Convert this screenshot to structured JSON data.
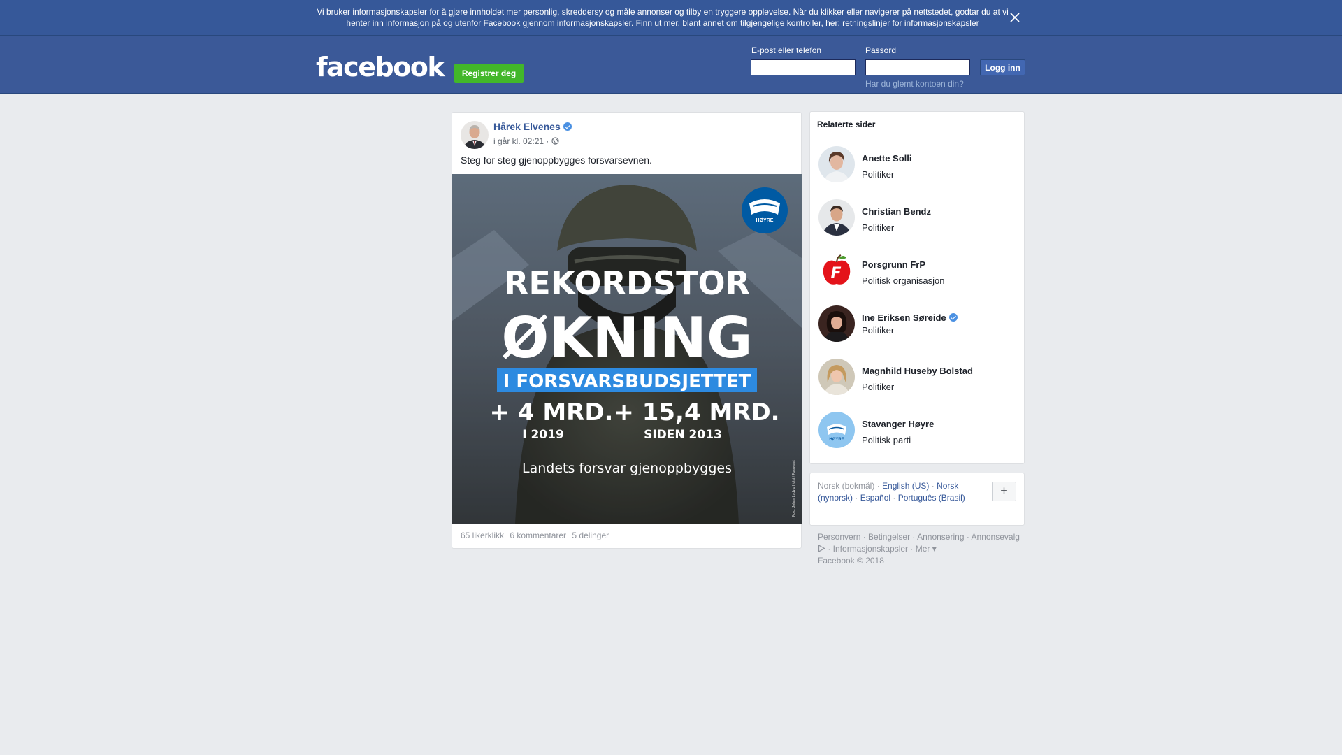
{
  "cookie_banner": {
    "text": "Vi bruker informasjonskapsler for å gjøre innholdet mer personlig, skreddersy og måle annonser og tilby en tryggere opplevelse. Når du klikker eller navigerer på nettstedet, godtar du at vi henter inn informasjon på og utenfor Facebook gjennom informasjonskapsler. Finn ut mer, blant annet om tilgjengelige kontroller, her:",
    "link": "retningslinjer for informasjonskapsler",
    "close_icon": "close-icon"
  },
  "header": {
    "logo": "facebook",
    "register_label": "Registrer deg",
    "email_label": "E-post eller telefon",
    "email_value": "",
    "password_label": "Passord",
    "password_value": "",
    "login_label": "Logg inn",
    "forgot_label": "Har du glemt kontoen din?"
  },
  "post": {
    "author": "Hårek Elvenes",
    "verified": true,
    "timestamp": "i går kl. 02:21",
    "separator": "·",
    "privacy_icon": "globe-icon",
    "text": "Steg for steg gjenoppbygges forsvarsevnen.",
    "image": {
      "line1": "REKORDSTOR",
      "line2": "ØKNING",
      "banner": "I FORSVARSBUDSJETTET",
      "stat1_value": "+ 4 MRD.",
      "stat1_label": "I 2019",
      "stat2_value": "+ 15,4 MRD.",
      "stat2_label": "SIDEN 2013",
      "tagline": "Landets forsvar gjenoppbygges",
      "logo_text": "HØYRE",
      "credit": "Foto: Johan Ludvig Holst / Forsvaret"
    },
    "likes": "65 likerklikk",
    "comments": "6 kommentarer",
    "shares": "5 delinger"
  },
  "related": {
    "title": "Relaterte sider",
    "items": [
      {
        "name": "Anette Solli",
        "category": "Politiker",
        "verified": false
      },
      {
        "name": "Christian Bendz",
        "category": "Politiker",
        "verified": false
      },
      {
        "name": "Porsgrunn FrP",
        "category": "Politisk organisasjon",
        "verified": false
      },
      {
        "name": "Ine Eriksen Søreide",
        "category": "Politiker",
        "verified": true
      },
      {
        "name": "Magnhild Huseby Bolstad",
        "category": "Politiker",
        "verified": false
      },
      {
        "name": "Stavanger Høyre",
        "category": "Politisk parti",
        "verified": false
      }
    ]
  },
  "languages": {
    "current": "Norsk (bokmål)",
    "options": [
      "English (US)",
      "Norsk (nynorsk)",
      "Español",
      "Português (Brasil)"
    ],
    "add_label": "+"
  },
  "footer": {
    "links": [
      "Personvern",
      "Betingelser",
      "Annonsering",
      "Annonsevalg",
      "Informasjonskapsler",
      "Mer"
    ],
    "copyright": "Facebook © 2018"
  }
}
